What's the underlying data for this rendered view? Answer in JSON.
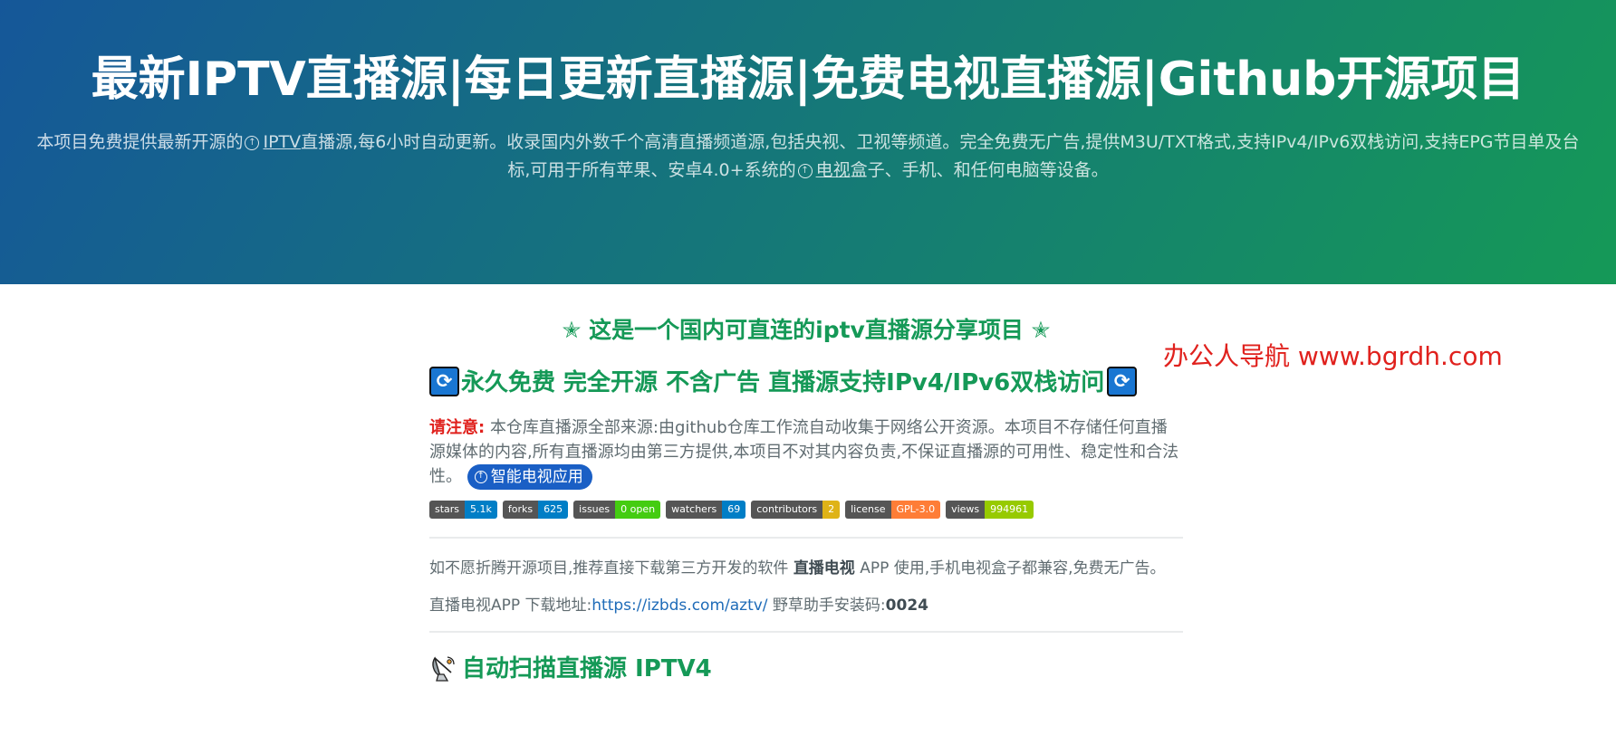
{
  "header": {
    "title": "最新IPTV直播源|每日更新直播源|免费电视直播源|Github开源项目",
    "tagline_part1": "本项目免费提供最新开源的",
    "tagline_link1": "IPTV",
    "tagline_part2": "直播源,每6小时自动更新。收录国内外数千个高清直播频道源,包括央视、卫视等频道。完全免费无广告,提供M3U/TXT格式,支持IPv4/IPv6双栈访问,支持EPG节目单及台标,可用于所有苹果、安卓4.0+系统的",
    "tagline_link2": "电视",
    "tagline_part3": "盒子、手机、和任何电脑等设备。"
  },
  "watermark": "办公人导航  www.bgrdh.com",
  "content": {
    "star_line": "✭ 这是一个国内可直连的iptv直播源分享项目 ✭",
    "promo_title": "永久免费 完全开源 不含广告 直播源支持IPv4/IPv6双栈访问",
    "notice_label": "请注意:",
    "notice_text": "本仓库直播源全部来源:由github仓库工作流自动收集于网络公开资源。本项目不存储任何直播源媒体的内容,所有直播源均由第三方提供,本项目不对其内容负责,不保证直播源的可用性、稳定性和合法性。",
    "app_pill": "智能电视应用",
    "badges": [
      {
        "label": "stars",
        "value": "5.1k",
        "color": "#007ec6"
      },
      {
        "label": "forks",
        "value": "625",
        "color": "#007ec6"
      },
      {
        "label": "issues",
        "value": "0 open",
        "color": "#4c1"
      },
      {
        "label": "watchers",
        "value": "69",
        "color": "#007ec6"
      },
      {
        "label": "contributors",
        "value": "2",
        "color": "#dfb317"
      },
      {
        "label": "license",
        "value": "GPL-3.0",
        "color": "#fe7d37"
      },
      {
        "label": "views",
        "value": "994961",
        "color": "#97ca00"
      }
    ],
    "para1_a": "如不愿折腾开源项目,推荐直接下载第三方开发的软件 ",
    "para1_bold": "直播电视",
    "para1_b": " APP 使用,手机电视盒子都兼容,免费无广告。",
    "para2_a": "直播电视APP 下载地址:",
    "para2_link": "https://izbds.com/aztv/",
    "para2_b": " 野草助手安装码:",
    "para2_code": "0024",
    "section_title": "自动扫描直播源 IPTV4"
  },
  "colors": {
    "gradient_start": "#155799",
    "gradient_end": "#159957",
    "accent_green": "#159957",
    "warning_red": "#e0211d",
    "link_blue": "#1e6bb8"
  }
}
